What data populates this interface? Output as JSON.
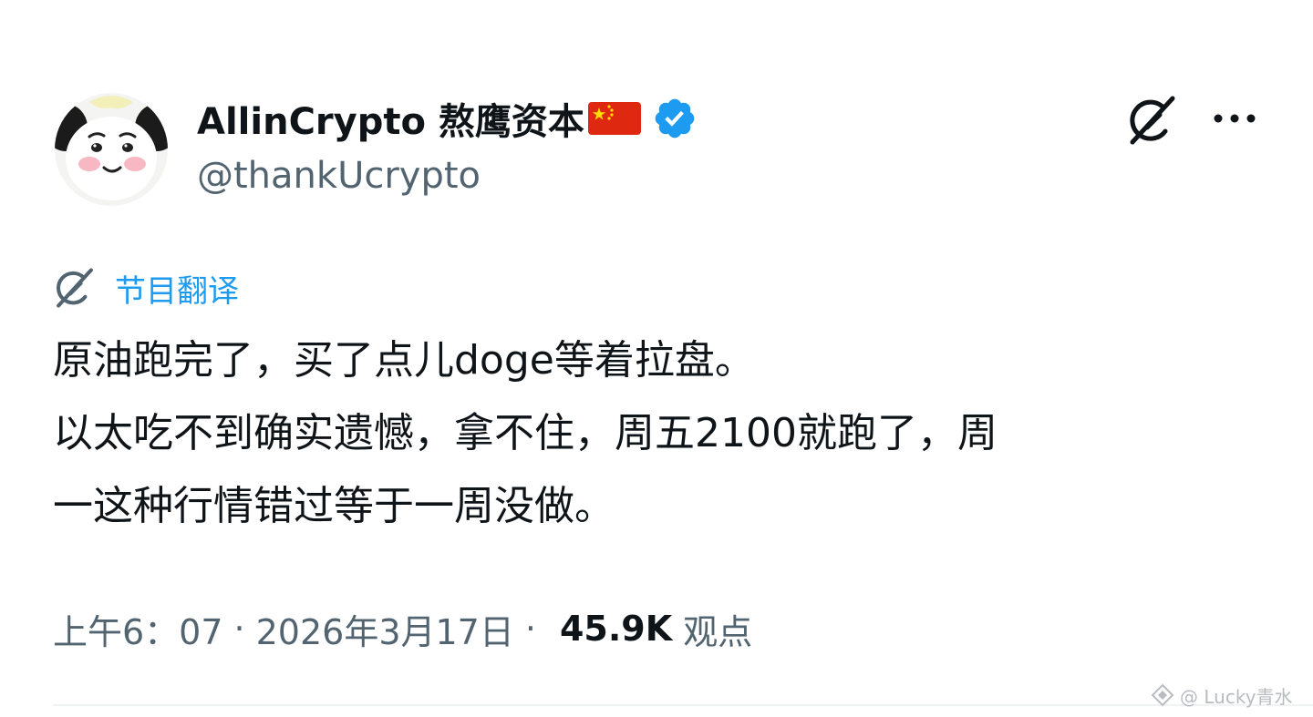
{
  "author": {
    "display_name": "AllinCrypto 熬鹰资本",
    "handle": "@thankUcrypto",
    "flag_icon": "china-flag-icon",
    "verified_icon": "verified-badge-icon",
    "verified_color": "#1d9bf0"
  },
  "header_actions": {
    "grok_icon": "grok-icon",
    "more_icon": "more-options-icon"
  },
  "translate": {
    "label": "节目翻译",
    "icon": "grok-icon"
  },
  "tweet": {
    "lines": [
      "原油跑完了，买了点儿doge等着拉盘。",
      "以太吃不到确实遗憾，拿不住，周五2100就跑了，周",
      "一这种行情错过等于一周没做。"
    ]
  },
  "meta": {
    "time": "上午6：07",
    "date": "2026年3月17日",
    "separator": "·",
    "views_count": "45.9K",
    "views_label": "观点"
  },
  "watermark": {
    "text": "@ Lucky青水"
  },
  "colors": {
    "text_primary": "#0f1419",
    "text_secondary": "#536471",
    "accent": "#1d9bf0",
    "divider": "#eff3f4"
  }
}
